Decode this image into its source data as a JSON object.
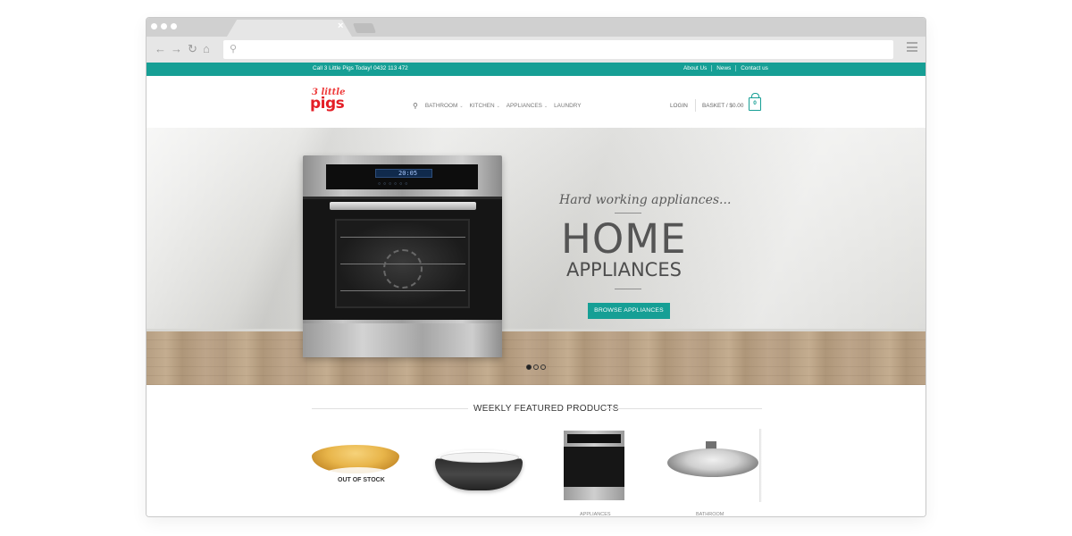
{
  "browser": {
    "close_glyph": "×",
    "back_glyph": "←",
    "forward_glyph": "→",
    "reload_glyph": "↻",
    "home_glyph": "⌂",
    "search_glyph": "⚲"
  },
  "topbar": {
    "phone_text": "Call 3 Little Pigs Today! 0432 113 472",
    "links": [
      "About Us",
      "News",
      "Contact us"
    ],
    "color": "#169f95"
  },
  "header": {
    "logo_small": "3 little",
    "logo_big": "pigs",
    "nav": [
      "BATHROOM",
      "KITCHEN",
      "APPLIANCES",
      "LAUNDRY"
    ],
    "login": "LOGIN",
    "basket": "BASKET / $0.00",
    "cart_count": "0"
  },
  "hero": {
    "oven_display": "20:05",
    "tagline": "Hard working appliances...",
    "headline": "HOME",
    "subhead": "APPLIANCES",
    "cta": "BROWSE APPLIANCES",
    "slides": 3,
    "active_slide": 1
  },
  "featured": {
    "title": "WEEKLY FEATURED PRODUCTS",
    "out_of_stock": "OUT OF STOCK",
    "labels": [
      "APPLIANCES",
      "BATHROOM"
    ]
  }
}
